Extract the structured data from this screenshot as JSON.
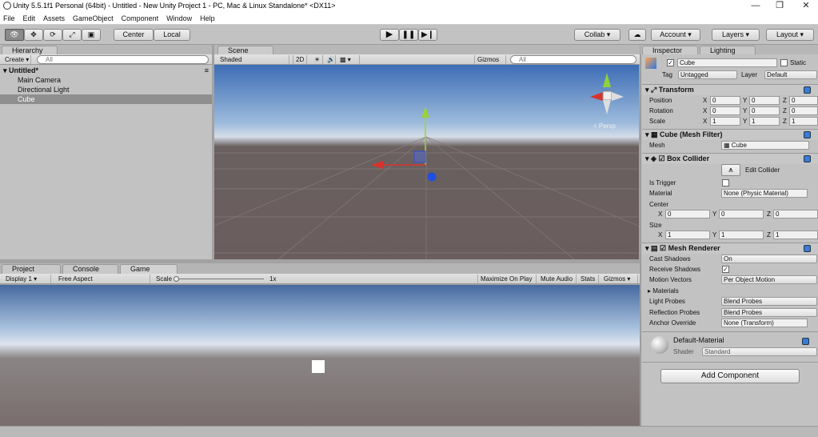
{
  "window": {
    "title": "Unity 5.5.1f1 Personal (64bit) - Untitled - New Unity Project 1 - PC, Mac & Linux Standalone* <DX11>"
  },
  "menu": [
    "File",
    "Edit",
    "Assets",
    "GameObject",
    "Component",
    "Window",
    "Help"
  ],
  "toolbar": {
    "center": "Center",
    "local": "Local",
    "collab": "Collab ▾",
    "account": "Account",
    "layers": "Layers",
    "layout": "Layout"
  },
  "hierarchy": {
    "tab": "Hierarchy",
    "create": "Create",
    "search": "All",
    "scene": "Untitled*",
    "items": [
      "Main Camera",
      "Directional Light",
      "Cube"
    ]
  },
  "scene": {
    "tab": "Scene",
    "shaded": "Shaded",
    "twod": "2D",
    "gizmos": "Gizmos",
    "search": "All",
    "persp": "Persp"
  },
  "bottom": {
    "tabs": [
      "Project",
      "Console",
      "Game"
    ],
    "display": "Display 1",
    "aspect": "Free Aspect",
    "scale_label": "Scale",
    "scale_value": "1x",
    "maximize": "Maximize On Play",
    "mute": "Mute Audio",
    "stats": "Stats",
    "gizmos": "Gizmos"
  },
  "inspector": {
    "tabs": [
      "Inspector",
      "Lighting"
    ],
    "name": "Cube",
    "static": "Static",
    "tag_label": "Tag",
    "tag": "Untagged",
    "layer_label": "Layer",
    "layer": "Default",
    "transform": {
      "title": "Transform",
      "position": "Position",
      "rotation": "Rotation",
      "scale": "Scale",
      "pos": [
        "0",
        "0",
        "0"
      ],
      "rot": [
        "0",
        "0",
        "0"
      ],
      "scl": [
        "1",
        "1",
        "1"
      ]
    },
    "meshfilter": {
      "title": "Cube (Mesh Filter)",
      "mesh_label": "Mesh",
      "mesh": "Cube"
    },
    "boxcollider": {
      "title": "Box Collider",
      "edit": "Edit Collider",
      "is_trigger": "Is Trigger",
      "material_label": "Material",
      "material": "None (Physic Material)",
      "center": "Center",
      "size": "Size",
      "c": [
        "0",
        "0",
        "0"
      ],
      "s": [
        "1",
        "1",
        "1"
      ]
    },
    "meshrenderer": {
      "title": "Mesh Renderer",
      "cast": "Cast Shadows",
      "cast_v": "On",
      "receive": "Receive Shadows",
      "motion": "Motion Vectors",
      "motion_v": "Per Object Motion",
      "materials": "Materials",
      "lightprobes": "Light Probes",
      "lightprobes_v": "Blend Probes",
      "reflprobes": "Reflection Probes",
      "reflprobes_v": "Blend Probes",
      "anchor": "Anchor Override",
      "anchor_v": "None (Transform)"
    },
    "material": {
      "name": "Default-Material",
      "shader_label": "Shader",
      "shader": "Standard"
    },
    "add": "Add Component"
  },
  "axes": {
    "x": "X",
    "y": "Y",
    "z": "Z"
  }
}
